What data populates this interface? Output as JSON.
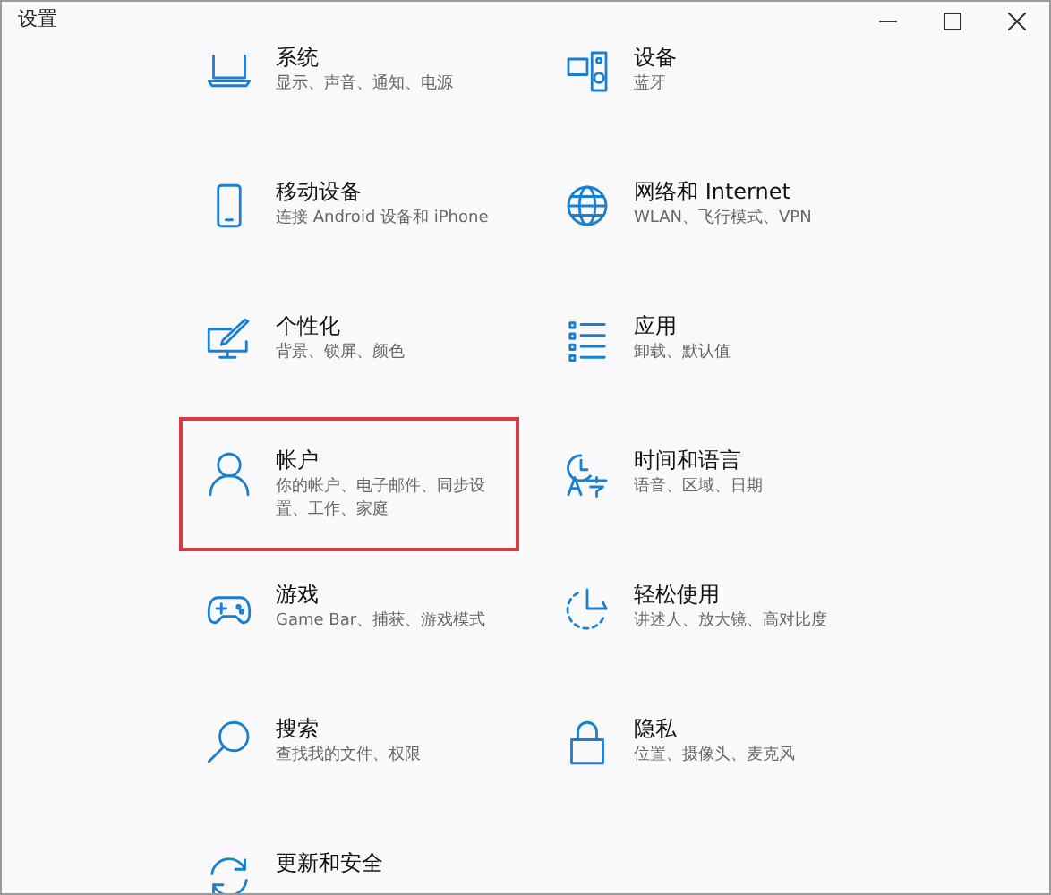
{
  "window": {
    "title": "设置"
  },
  "items": [
    {
      "kind": "laptop",
      "title": "系统",
      "subtitle": "显示、声音、通知、电源",
      "selected": false
    },
    {
      "kind": "devices",
      "title": "设备",
      "subtitle": "蓝牙",
      "selected": false
    },
    {
      "kind": "phone",
      "title": "移动设备",
      "subtitle": "连接 Android 设备和 iPhone",
      "selected": false
    },
    {
      "kind": "globe",
      "title": "网络和 Internet",
      "subtitle": "WLAN、飞行模式、VPN",
      "selected": false
    },
    {
      "kind": "brush",
      "title": "个性化",
      "subtitle": "背景、锁屏、颜色",
      "selected": false
    },
    {
      "kind": "list",
      "title": "应用",
      "subtitle": "卸载、默认值",
      "selected": false
    },
    {
      "kind": "person",
      "title": "帐户",
      "subtitle": "你的帐户、电子邮件、同步设置、工作、家庭",
      "selected": true
    },
    {
      "kind": "language",
      "title": "时间和语言",
      "subtitle": "语音、区域、日期",
      "selected": false
    },
    {
      "kind": "gamepad",
      "title": "游戏",
      "subtitle": "Game Bar、捕获、游戏模式",
      "selected": false
    },
    {
      "kind": "ease",
      "title": "轻松使用",
      "subtitle": "讲述人、放大镜、高对比度",
      "selected": false
    },
    {
      "kind": "search",
      "title": "搜索",
      "subtitle": "查找我的文件、权限",
      "selected": false
    },
    {
      "kind": "lock",
      "title": "隐私",
      "subtitle": "位置、摄像头、麦克风",
      "selected": false
    },
    {
      "kind": "sync",
      "title": "更新和安全",
      "selected": false
    }
  ]
}
